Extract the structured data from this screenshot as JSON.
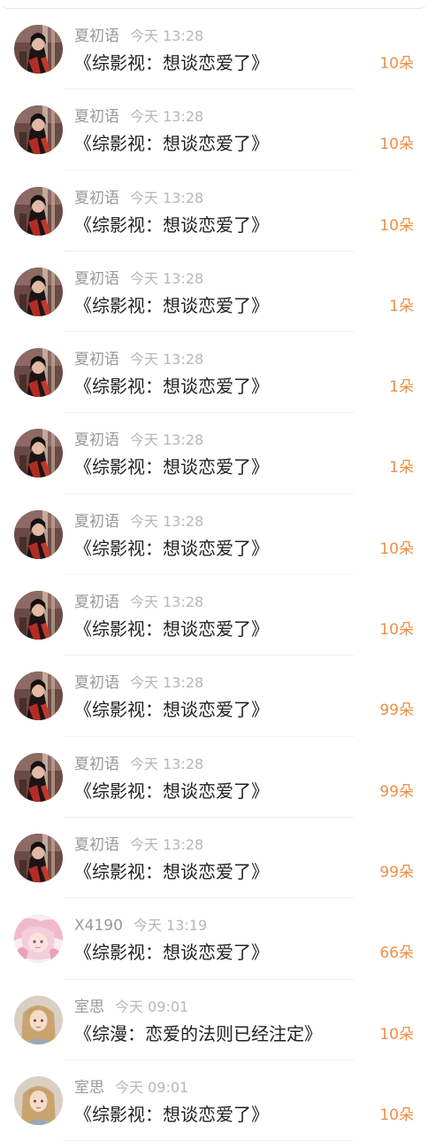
{
  "colors": {
    "name": "#9a9a9a",
    "time": "#b7b7b7",
    "title": "#222222",
    "amount": "#ee8f45",
    "divider": "#f1f1f1"
  },
  "rows": [
    {
      "avatar": "avatar-dark-costume",
      "name": "夏初语",
      "time": "今天 13:28",
      "title": "《综影视：想谈恋爱了》",
      "amount": "10朵"
    },
    {
      "avatar": "avatar-dark-costume",
      "name": "夏初语",
      "time": "今天 13:28",
      "title": "《综影视：想谈恋爱了》",
      "amount": "10朵"
    },
    {
      "avatar": "avatar-dark-costume",
      "name": "夏初语",
      "time": "今天 13:28",
      "title": "《综影视：想谈恋爱了》",
      "amount": "10朵"
    },
    {
      "avatar": "avatar-dark-costume",
      "name": "夏初语",
      "time": "今天 13:28",
      "title": "《综影视：想谈恋爱了》",
      "amount": "1朵"
    },
    {
      "avatar": "avatar-dark-costume",
      "name": "夏初语",
      "time": "今天 13:28",
      "title": "《综影视：想谈恋爱了》",
      "amount": "1朵"
    },
    {
      "avatar": "avatar-dark-costume",
      "name": "夏初语",
      "time": "今天 13:28",
      "title": "《综影视：想谈恋爱了》",
      "amount": "1朵"
    },
    {
      "avatar": "avatar-dark-costume",
      "name": "夏初语",
      "time": "今天 13:28",
      "title": "《综影视：想谈恋爱了》",
      "amount": "10朵"
    },
    {
      "avatar": "avatar-dark-costume",
      "name": "夏初语",
      "time": "今天 13:28",
      "title": "《综影视：想谈恋爱了》",
      "amount": "10朵"
    },
    {
      "avatar": "avatar-dark-costume",
      "name": "夏初语",
      "time": "今天 13:28",
      "title": "《综影视：想谈恋爱了》",
      "amount": "99朵"
    },
    {
      "avatar": "avatar-dark-costume",
      "name": "夏初语",
      "time": "今天 13:28",
      "title": "《综影视：想谈恋爱了》",
      "amount": "99朵"
    },
    {
      "avatar": "avatar-dark-costume",
      "name": "夏初语",
      "time": "今天 13:28",
      "title": "《综影视：想谈恋爱了》",
      "amount": "99朵"
    },
    {
      "avatar": "avatar-pink-anime",
      "name": "X4190",
      "time": "今天 13:19",
      "title": "《综影视：想谈恋爱了》",
      "amount": "66朵"
    },
    {
      "avatar": "avatar-blonde-girl",
      "name": "室思",
      "time": "今天 09:01",
      "title": "《综漫：恋爱的法则已经注定》",
      "amount": "10朵"
    },
    {
      "avatar": "avatar-blonde-girl",
      "name": "室思",
      "time": "今天 09:01",
      "title": "《综影视：想谈恋爱了》",
      "amount": "10朵"
    }
  ]
}
